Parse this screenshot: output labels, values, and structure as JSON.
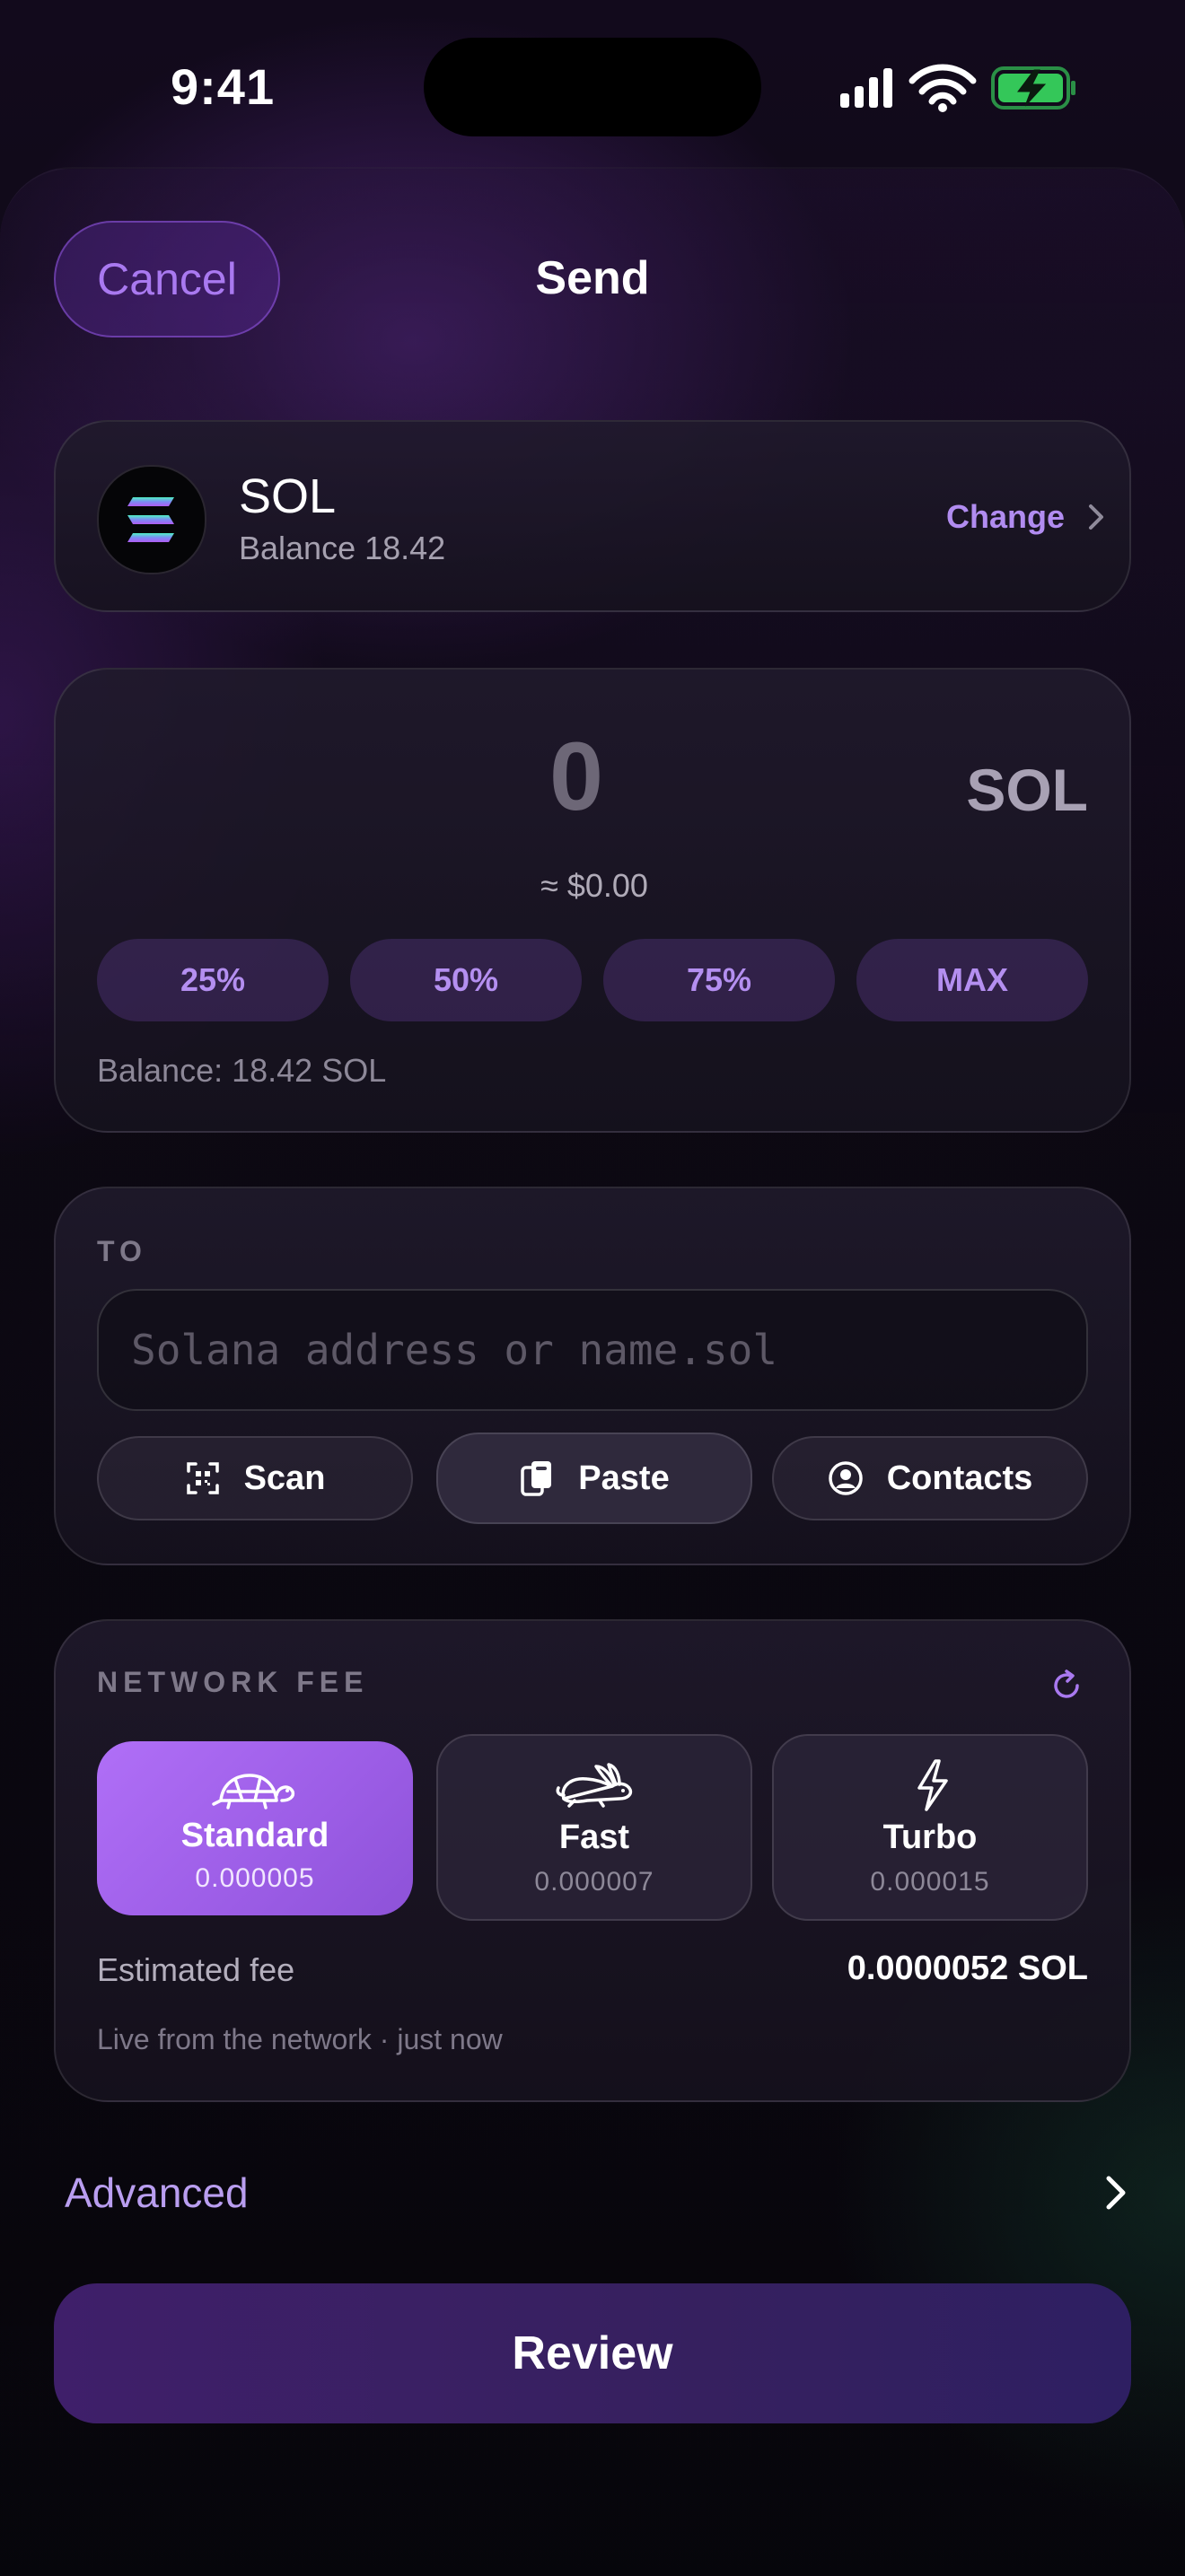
{
  "status_bar": {
    "time": "9:41",
    "battery_color": "#34c759"
  },
  "header": {
    "cancel_label": "Cancel",
    "title": "Send"
  },
  "token": {
    "symbol": "SOL",
    "balance_label": "Balance 18.42",
    "change_label": "Change",
    "logo_colors": [
      "#4ef0c4",
      "#7d8bf5",
      "#b05cf2"
    ]
  },
  "amount": {
    "value": "0",
    "unit": "SOL",
    "fiat": "≈ $0.00",
    "presets": [
      "25%",
      "50%",
      "75%",
      "MAX"
    ],
    "balance_text": "Balance: 18.42 SOL"
  },
  "recipient": {
    "section_label": "TO",
    "placeholder": "Solana address or name.sol",
    "value": "",
    "actions": {
      "scan": "Scan",
      "paste": "Paste",
      "contacts": "Contacts"
    }
  },
  "fee": {
    "section_label": "NETWORK FEE",
    "options": [
      {
        "name": "Standard",
        "price": "0.000005",
        "icon": "turtle-icon",
        "selected": true
      },
      {
        "name": "Fast",
        "price": "0.000007",
        "icon": "rabbit-icon",
        "selected": false
      },
      {
        "name": "Turbo",
        "price": "0.000015",
        "icon": "lightning-icon",
        "selected": false
      }
    ],
    "estimated_label": "Estimated fee",
    "estimated_value": "0.0000052 SOL",
    "live_note": "Live from the network · just now"
  },
  "advanced_label": "Advanced",
  "review_label": "Review",
  "colors": {
    "accent": "#a979f0",
    "selected_fee": "#a866f2",
    "review_button": "#3a2066"
  }
}
